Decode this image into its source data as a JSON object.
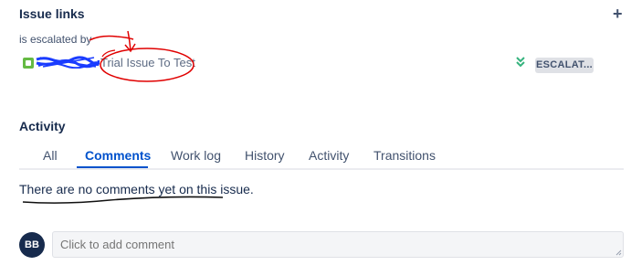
{
  "issue_links": {
    "title": "Issue links",
    "add_icon_glyph": "+",
    "relation_label": "is escalated by",
    "linked_issue": {
      "type_icon": "story-icon",
      "summary": "Trial Issue To Test",
      "priority_icon": "lowest-priority-icon",
      "status": "ESCALAT..."
    }
  },
  "activity": {
    "title": "Activity",
    "tabs": [
      {
        "label": "All"
      },
      {
        "label": "Comments",
        "active": true
      },
      {
        "label": "Work log"
      },
      {
        "label": "History"
      },
      {
        "label": "Activity"
      },
      {
        "label": "Transitions"
      }
    ],
    "empty_message": "There are no comments yet on this issue."
  },
  "comment": {
    "avatar_initials": "BB",
    "placeholder": "Click to add comment"
  },
  "colors": {
    "accent": "#0052cc",
    "story_green": "#65ba43",
    "priority_green": "#36b37e",
    "annotation_red": "#e00000",
    "redaction_blue": "#1a3cff"
  }
}
